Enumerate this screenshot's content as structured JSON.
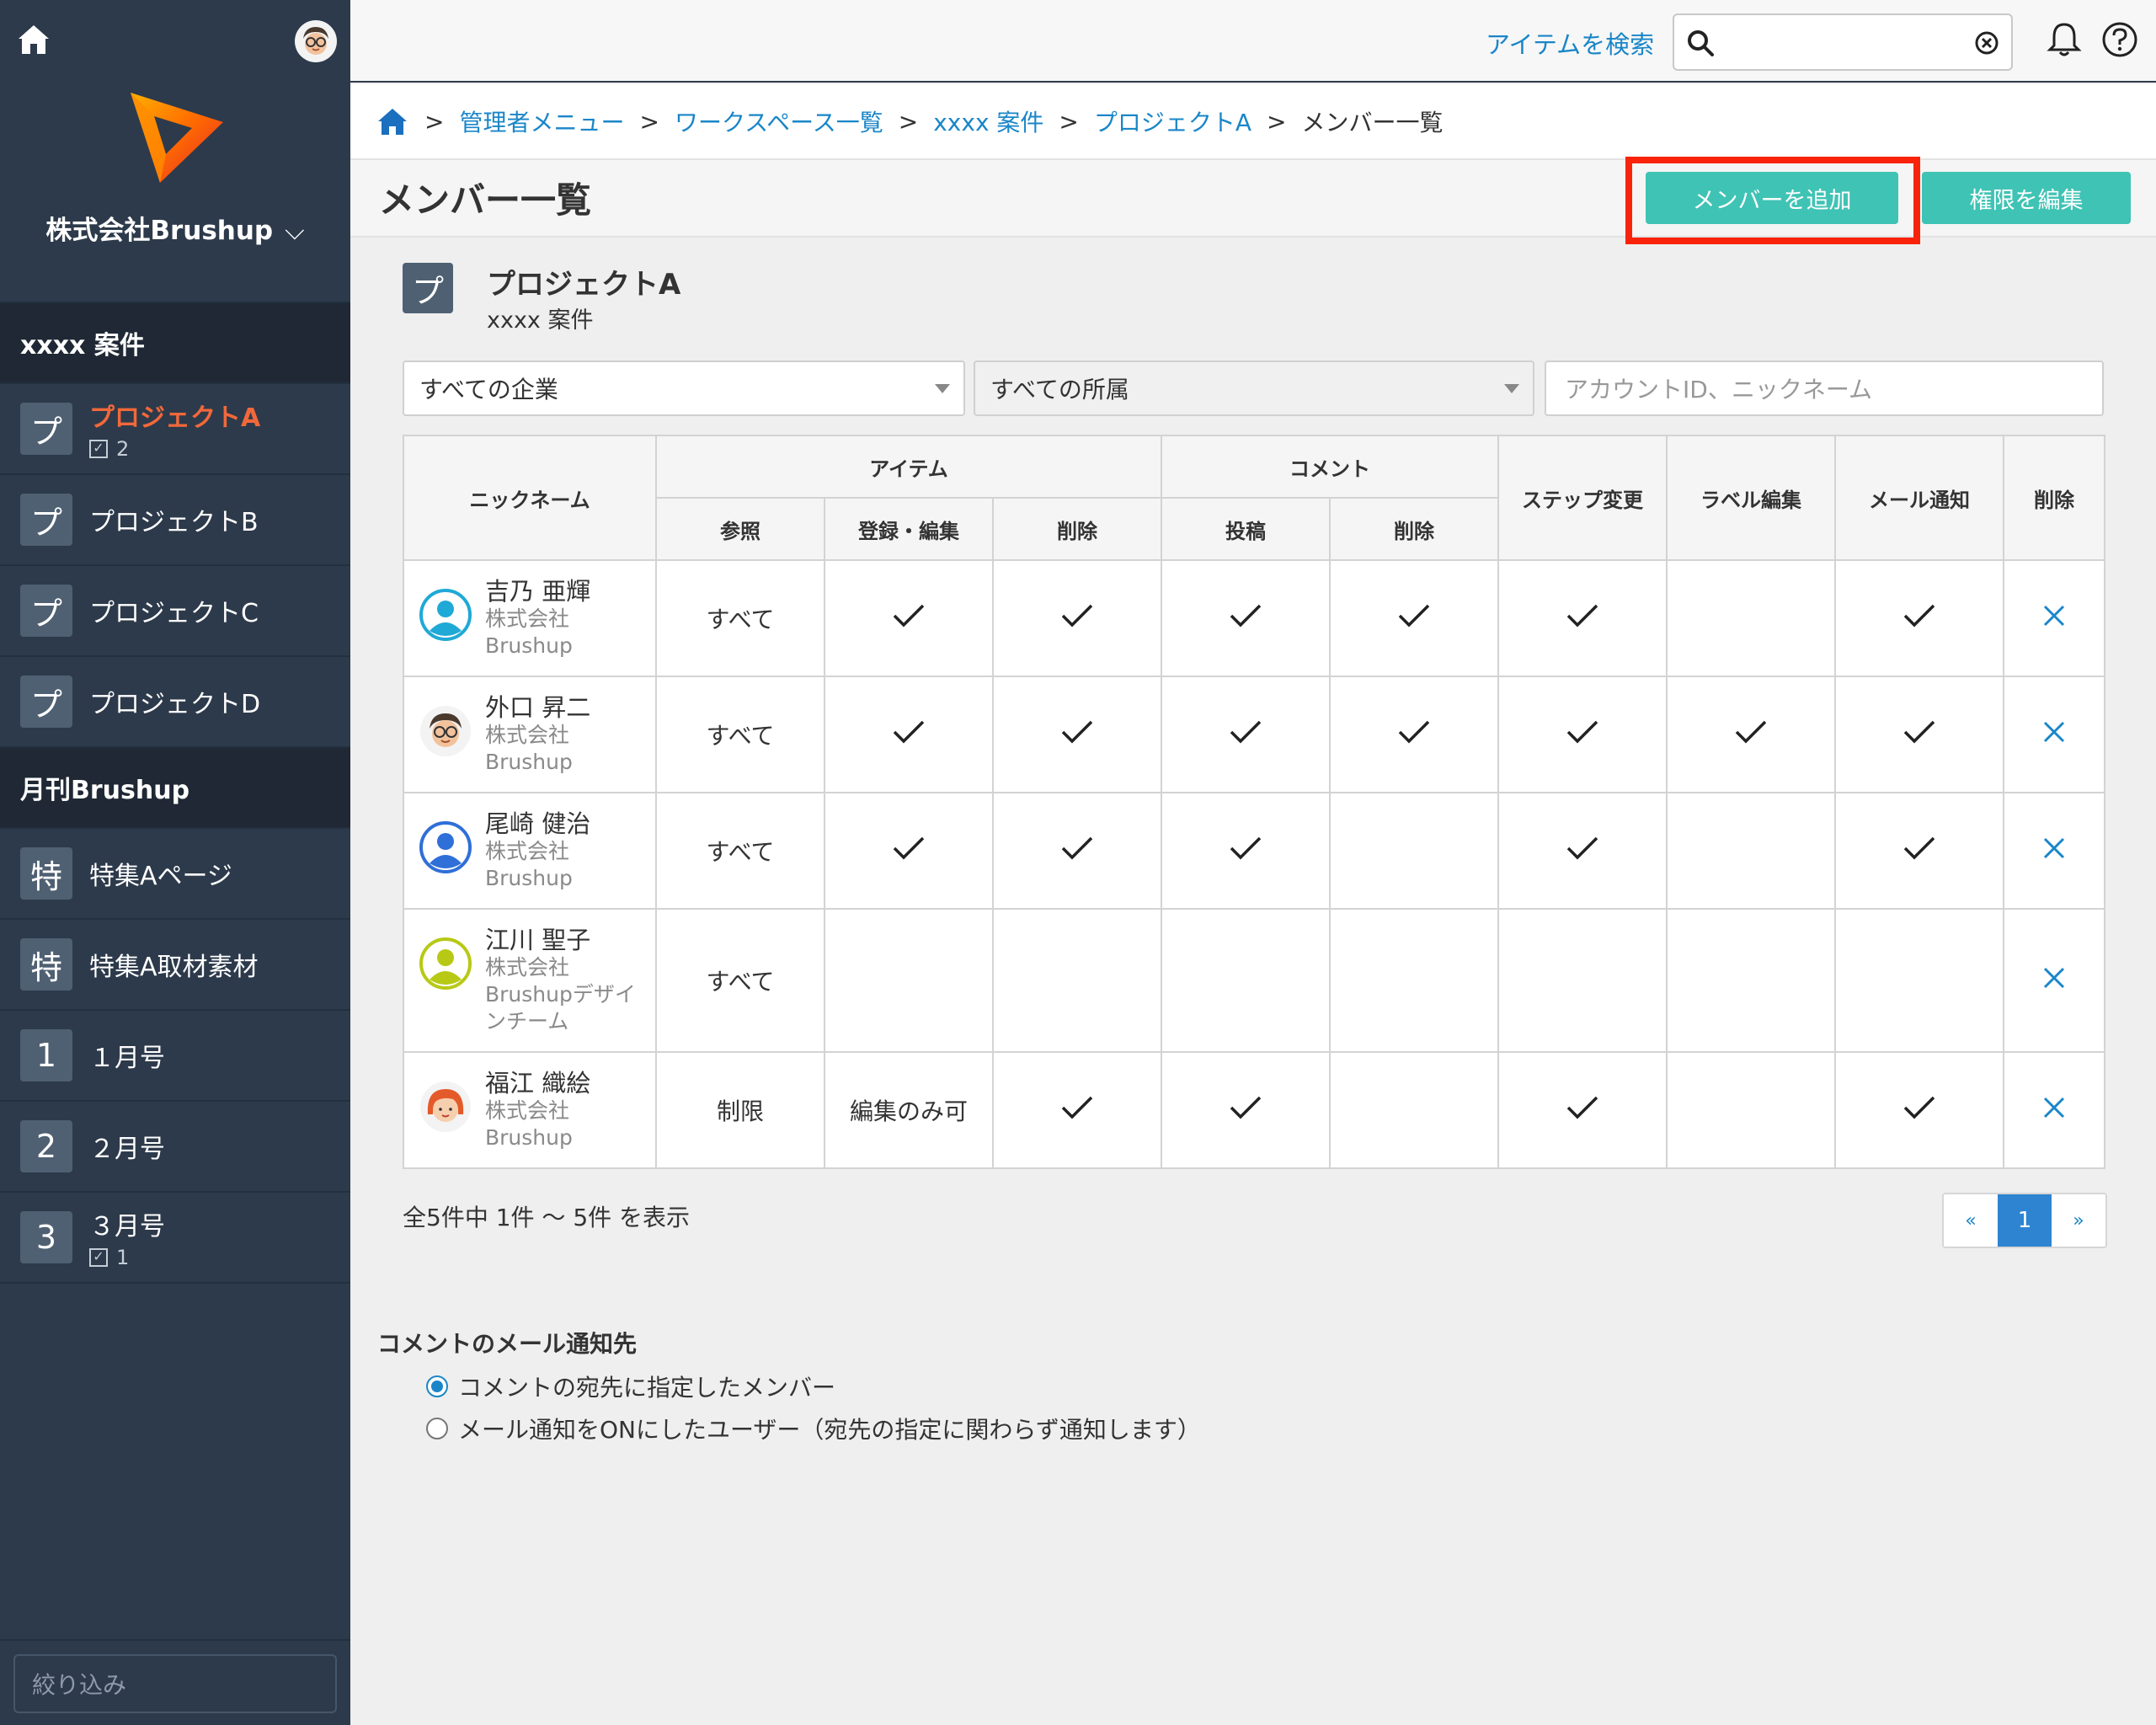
{
  "sidebar": {
    "company": "株式会社Brushup",
    "filter_placeholder": "絞り込み",
    "sections": [
      {
        "title": "xxxx 案件",
        "items": [
          {
            "badge": "プ",
            "label": "プロジェクトA",
            "count": "2",
            "active": true
          },
          {
            "badge": "プ",
            "label": "プロジェクトB"
          },
          {
            "badge": "プ",
            "label": "プロジェクトC"
          },
          {
            "badge": "プ",
            "label": "プロジェクトD"
          }
        ]
      },
      {
        "title": "月刊Brushup",
        "items": [
          {
            "badge": "特",
            "label": "特集Aページ"
          },
          {
            "badge": "特",
            "label": "特集A取材素材"
          },
          {
            "badge": "1",
            "label": "１月号"
          },
          {
            "badge": "2",
            "label": "２月号"
          },
          {
            "badge": "3",
            "label": "３月号",
            "count": "1"
          }
        ]
      }
    ]
  },
  "topbar": {
    "search_label": "アイテムを検索",
    "search_value": ""
  },
  "breadcrumb": {
    "items": [
      "管理者メニュー",
      "ワークスペース一覧",
      "xxxx 案件",
      "プロジェクトA"
    ],
    "current": "メンバー一覧"
  },
  "header": {
    "title": "メンバー一覧",
    "add_member": "メンバーを追加",
    "edit_permissions": "権限を編集"
  },
  "project": {
    "badge": "プ",
    "name": "プロジェクトA",
    "sub": "xxxx 案件"
  },
  "filters": {
    "company": "すべての企業",
    "affiliation": "すべての所属",
    "account_placeholder": "アカウントID、ニックネーム"
  },
  "table": {
    "headers": {
      "nickname": "ニックネーム",
      "item": "アイテム",
      "comment": "コメント",
      "step": "ステップ変更",
      "label": "ラベル編集",
      "mail": "メール通知",
      "delete": "削除",
      "item_view": "参照",
      "item_edit": "登録・編集",
      "item_delete": "削除",
      "comment_post": "投稿",
      "comment_delete": "削除"
    },
    "rows": [
      {
        "name": "吉乃 亜輝",
        "company": "株式会社Brushup",
        "avatar": "default-cyan",
        "view": "すべて",
        "edit": true,
        "idel": true,
        "post": true,
        "cdel": true,
        "step": true,
        "label": false,
        "mail": true
      },
      {
        "name": "外口 昇二",
        "company": "株式会社Brushup",
        "avatar": "glasses-man",
        "view": "すべて",
        "edit": true,
        "idel": true,
        "post": true,
        "cdel": true,
        "step": true,
        "label": true,
        "mail": true
      },
      {
        "name": "尾崎 健治",
        "company": "株式会社Brushup",
        "avatar": "default-blue",
        "view": "すべて",
        "edit": true,
        "idel": true,
        "post": true,
        "cdel": false,
        "step": true,
        "label": false,
        "mail": true
      },
      {
        "name": "江川 聖子",
        "company": "株式会社Brushupデザインチーム",
        "avatar": "default-lime",
        "view": "すべて",
        "edit": false,
        "idel": false,
        "post": false,
        "cdel": false,
        "step": false,
        "label": false,
        "mail": false
      },
      {
        "name": "福江 織絵",
        "company": "株式会社Brushup",
        "avatar": "red-hair-woman",
        "view": "制限",
        "edit_text": "編集のみ可",
        "idel": true,
        "post": true,
        "cdel": false,
        "step": true,
        "label": false,
        "mail": true
      }
    ]
  },
  "pagination": {
    "summary": "全5件中 1件 〜 5件 を表示",
    "prev": "«",
    "current": "1",
    "next": "»"
  },
  "notify": {
    "title": "コメントのメール通知先",
    "option1": "コメントの宛先に指定したメンバー",
    "option2": "メール通知をONにしたユーザー（宛先の指定に関わらず通知します）",
    "selected": 1
  },
  "colors": {
    "sidebar_bg": "#2d3a4b",
    "accent_teal": "#3fc3b4",
    "link_blue": "#1a86c8",
    "active_orange": "#f2683a",
    "highlight_red": "#f9230c"
  }
}
